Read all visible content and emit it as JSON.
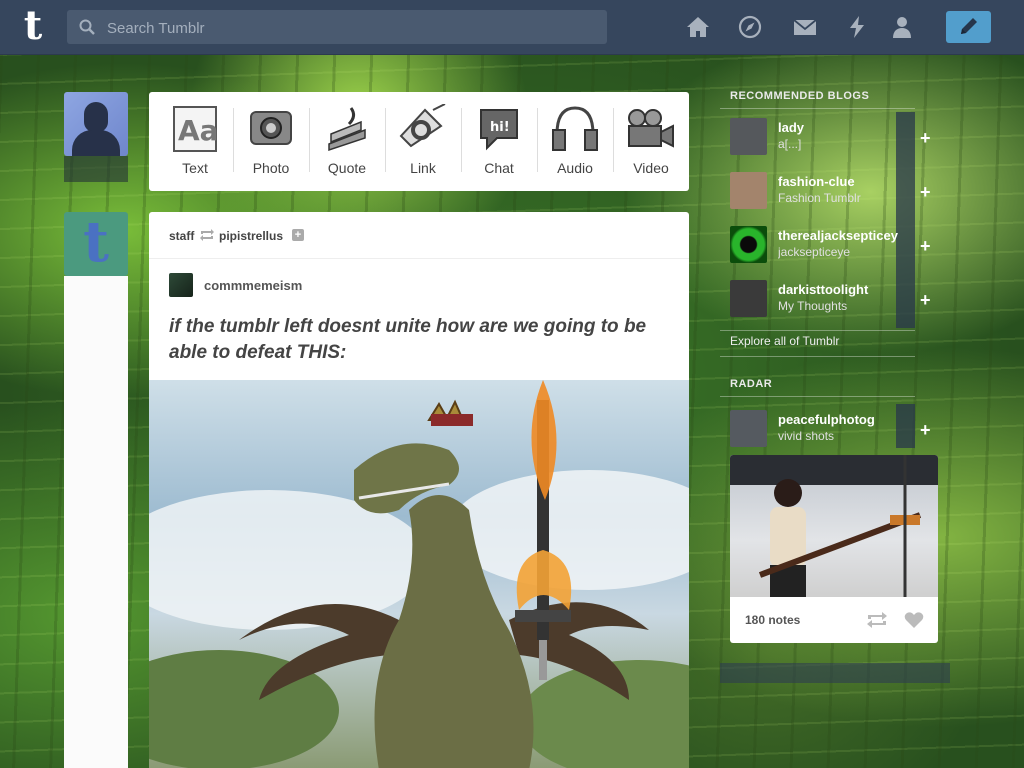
{
  "topbar": {
    "logo_letter": "t",
    "search_placeholder": "Search Tumblr",
    "nav_icons": [
      "home-icon",
      "explore-icon",
      "inbox-icon",
      "activity-icon",
      "account-icon"
    ],
    "compose_icon": "pencil-icon",
    "bar_color": "#36465d",
    "compose_color": "#529ecc"
  },
  "post_types": [
    {
      "label": "Text",
      "icon": "text-icon"
    },
    {
      "label": "Photo",
      "icon": "photo-icon"
    },
    {
      "label": "Quote",
      "icon": "quote-icon"
    },
    {
      "label": "Link",
      "icon": "link-icon"
    },
    {
      "label": "Chat",
      "icon": "chat-icon",
      "glyph": "hi!"
    },
    {
      "label": "Audio",
      "icon": "audio-icon"
    },
    {
      "label": "Video",
      "icon": "video-icon"
    }
  ],
  "post": {
    "poster": "staff",
    "reblogged_from": "pipistrellus",
    "follow_symbol": "+",
    "original_author": "commmemeism",
    "text": "if the tumblr left doesnt unite how are we going to be able to defeat THIS:"
  },
  "sidebar": {
    "recommended_title": "Recommended Blogs",
    "recommended": [
      {
        "name": "lady",
        "sub": "a[...]",
        "add": "+",
        "avatar_color": "#55585c"
      },
      {
        "name": "fashion-clue",
        "sub": "Fashion Tumblr",
        "add": "+",
        "avatar_color": "#a3846c"
      },
      {
        "name": "therealjacksepticey",
        "sub": "jacksepticeye",
        "add": "+",
        "avatar_color": "#1d7a1d"
      },
      {
        "name": "darkisttoolight",
        "sub": "My Thoughts",
        "add": "+",
        "avatar_color": "#3a3a3a"
      }
    ],
    "explore_text": "Explore all of Tumblr",
    "radar_title": "Radar",
    "radar_blog": {
      "name": "peacefulphotog",
      "sub": "vivid shots",
      "add": "+",
      "avatar_color": "#555a60"
    },
    "radar_notes": "180 notes"
  }
}
